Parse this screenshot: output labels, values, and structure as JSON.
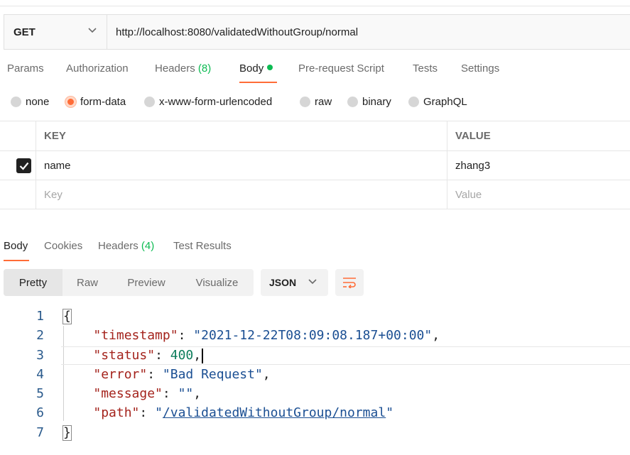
{
  "request": {
    "method": "GET",
    "url": "http://localhost:8080/validatedWithoutGroup/normal",
    "tabs": [
      {
        "label": "Params"
      },
      {
        "label": "Authorization"
      },
      {
        "label": "Headers",
        "count": "(8)"
      },
      {
        "label": "Body"
      },
      {
        "label": "Pre-request Script"
      },
      {
        "label": "Tests"
      },
      {
        "label": "Settings"
      }
    ],
    "active_tab": "Body",
    "body_types": [
      "none",
      "form-data",
      "x-www-form-urlencoded",
      "raw",
      "binary",
      "GraphQL"
    ],
    "selected_body_type": "form-data",
    "form": {
      "key_header": "KEY",
      "value_header": "VALUE",
      "rows": [
        {
          "key": "name",
          "value": "zhang3",
          "checked": true
        }
      ],
      "key_placeholder": "Key",
      "value_placeholder": "Value"
    }
  },
  "response": {
    "tabs": [
      {
        "label": "Body"
      },
      {
        "label": "Cookies"
      },
      {
        "label": "Headers",
        "count": "(4)"
      },
      {
        "label": "Test Results"
      }
    ],
    "active_tab": "Body",
    "views": [
      "Pretty",
      "Raw",
      "Preview",
      "Visualize"
    ],
    "selected_view": "Pretty",
    "format": "JSON",
    "code": {
      "line_numbers": [
        "1",
        "2",
        "3",
        "4",
        "5",
        "6",
        "7"
      ],
      "open_brace": "{",
      "close_brace": "}",
      "fields": [
        {
          "key": "\"timestamp\"",
          "value": "\"2021-12-22T08:09:08.187+00:00\""
        },
        {
          "key": "\"status\"",
          "value": "400"
        },
        {
          "key": "\"error\"",
          "value": "\"Bad Request\""
        },
        {
          "key": "\"message\"",
          "value": "\"\""
        },
        {
          "key": "\"path\"",
          "value_open": "\"",
          "value_link": "/validatedWithoutGroup/normal",
          "value_close": "\""
        }
      ]
    }
  },
  "colors": {
    "accent": "#ff6c37",
    "green": "#0cbb52",
    "json_key": "#a4231c",
    "json_string": "#1b4f93",
    "json_number": "#0d7d5c"
  }
}
